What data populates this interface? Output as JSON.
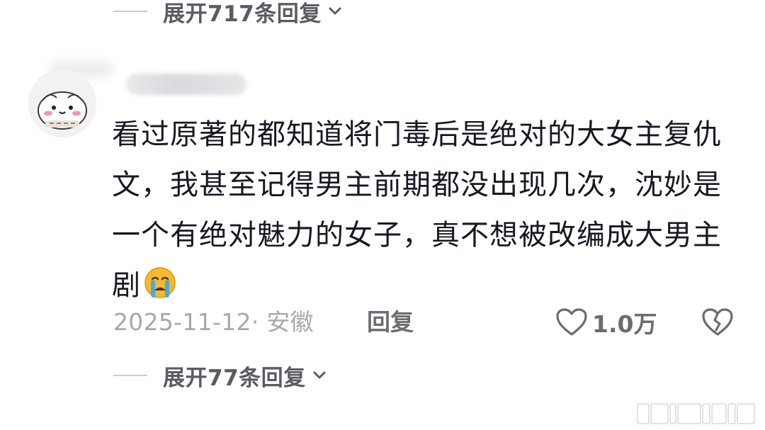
{
  "replies_top": {
    "label": "展开717条回复",
    "icon": "chevron-down-icon"
  },
  "comment": {
    "avatar_icon": "avatar-cartoon",
    "username": "",
    "text": "看过原著的都知道将门毒后是绝对的大女主复仇文，我甚至记得男主前期都没出现几次，沈妙是一个有绝对魅力的女子，真不想被改编成大男主剧",
    "emoji": "crying-face-emoji",
    "date_location": "2025-11-12· 安徽",
    "reply_label": "回复",
    "likes": "1.0万",
    "like_icon": "heart-icon",
    "dislike_icon": "broken-heart-icon"
  },
  "replies_bottom": {
    "label": "展开77条回复",
    "icon": "chevron-down-icon"
  },
  "colors": {
    "text_primary": "#161823",
    "text_secondary": "#a7a8ad",
    "text_action": "#6b6c73",
    "emoji_face": "#f5b92a",
    "emoji_tear": "#4aa8e8"
  }
}
